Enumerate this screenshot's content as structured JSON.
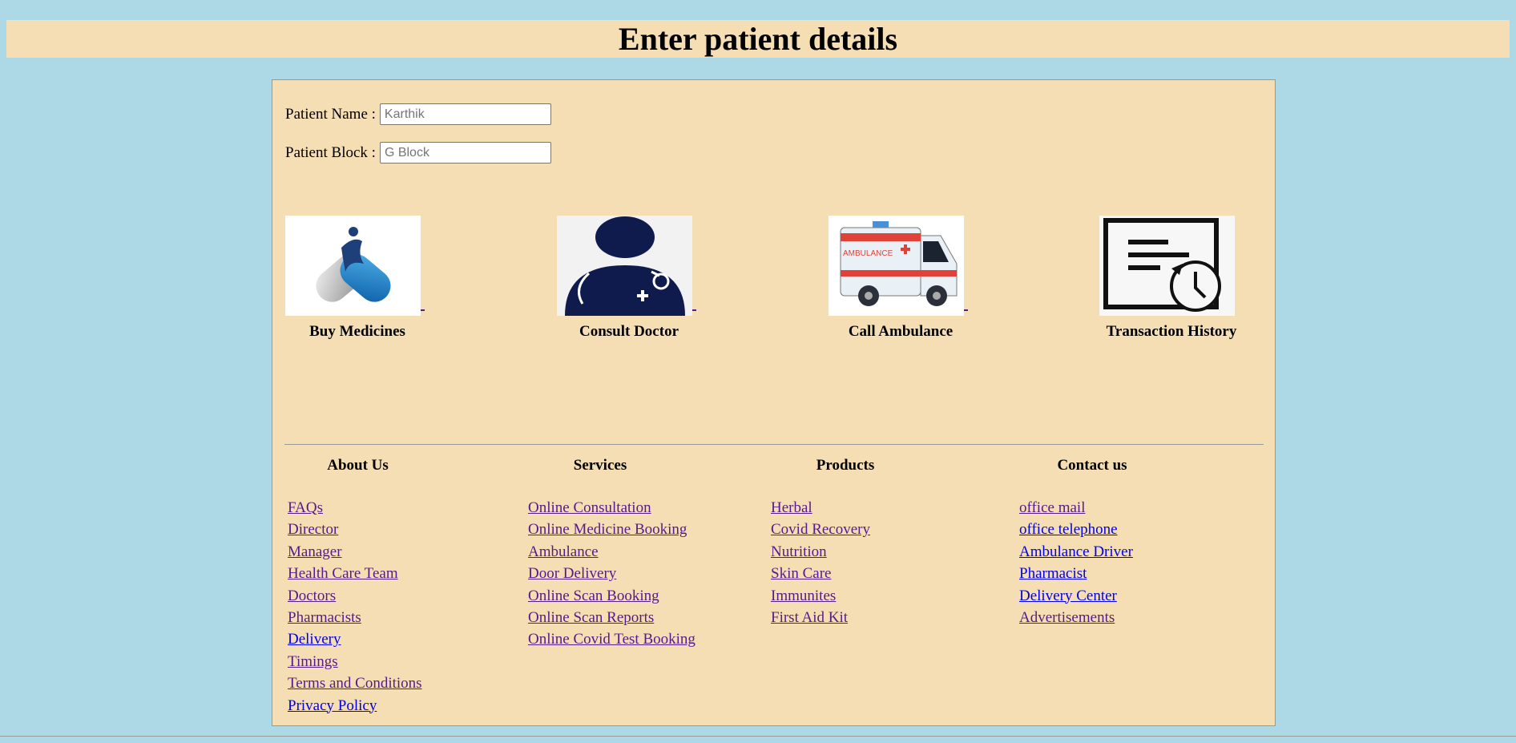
{
  "header": {
    "title": "Enter patient details"
  },
  "form": {
    "name_label": "Patient Name :",
    "name_placeholder": "Karthik",
    "block_label": "Patient Block :",
    "block_placeholder": "G Block"
  },
  "tiles": [
    {
      "label": "Buy Medicines",
      "icon": "medicine-capsule-icon"
    },
    {
      "label": "Consult Doctor",
      "icon": "doctor-icon"
    },
    {
      "label": "Call Ambulance",
      "icon": "ambulance-icon"
    },
    {
      "label": "Transaction History",
      "icon": "transaction-history-icon"
    }
  ],
  "footer": {
    "about": {
      "heading": "About Us",
      "links": [
        "FAQs",
        "Director",
        "Manager",
        "Health Care Team",
        "Doctors",
        "Pharmacists",
        "Delivery",
        "Timings",
        "Terms and Conditions",
        "Privacy Policy"
      ]
    },
    "services": {
      "heading": "Services",
      "links": [
        "Online Consultation",
        "Online Medicine Booking",
        "Ambulance",
        "Door Delivery",
        "Online Scan Booking",
        "Online Scan Reports",
        "Online Covid Test Booking"
      ]
    },
    "products": {
      "heading": "Products",
      "links": [
        "Herbal",
        "Covid Recovery",
        "Nutrition",
        "Skin Care",
        "Immunites",
        "First Aid Kit"
      ]
    },
    "contact": {
      "heading": "Contact us",
      "links": [
        "office mail",
        "office telephone",
        "Ambulance Driver",
        "Pharmacist",
        "Delivery Center",
        "Advertisements"
      ]
    }
  },
  "colors": {
    "page_bg": "#add8e6",
    "panel_bg": "#f5deb3",
    "link_visited": "#551a8b",
    "link": "#0000ee"
  }
}
